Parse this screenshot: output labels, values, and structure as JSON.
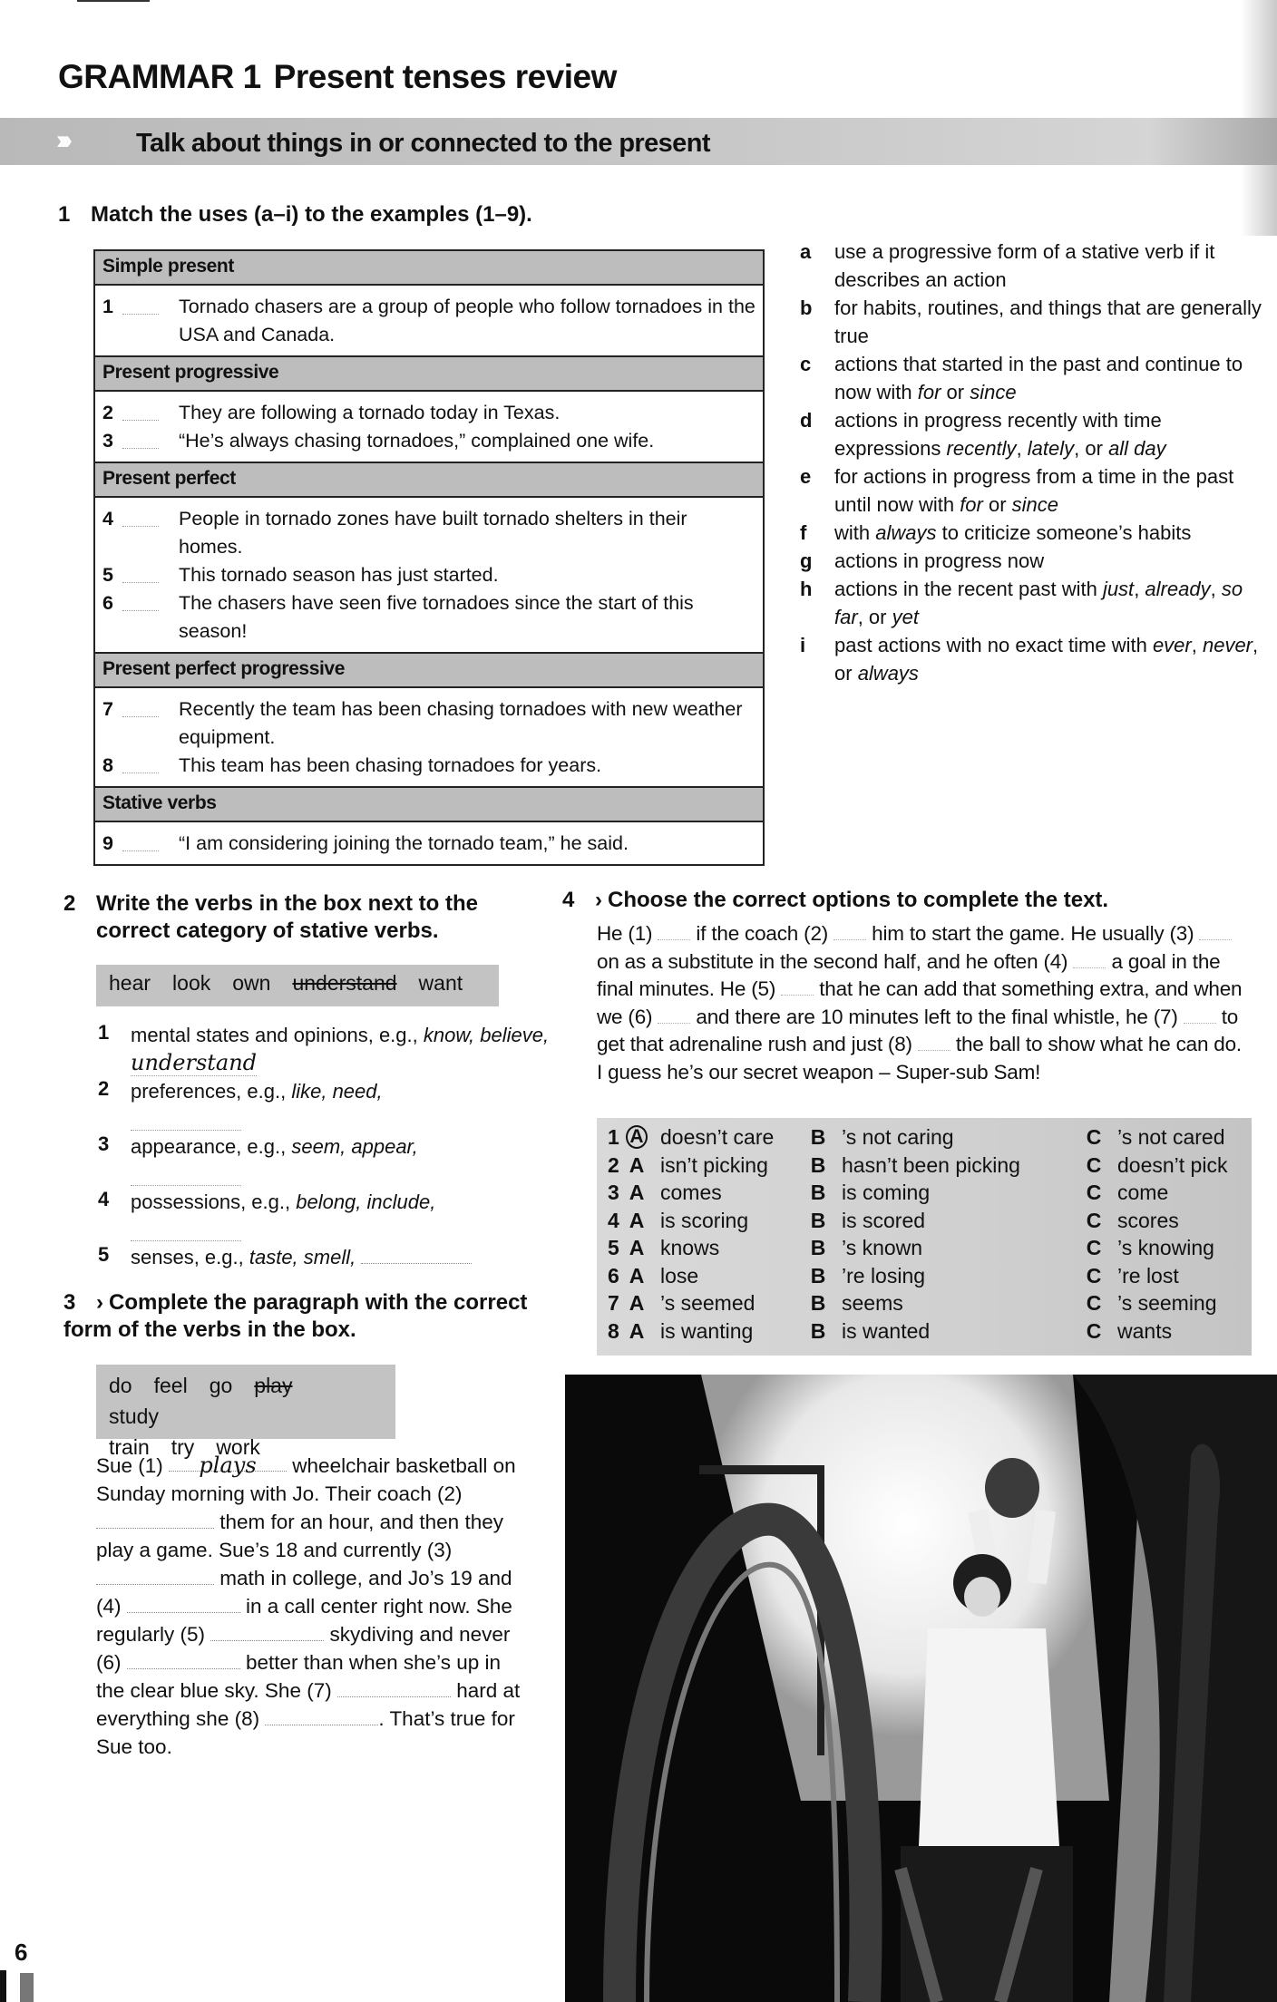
{
  "header": {
    "unit": "GRAMMAR 1",
    "title": "Present tenses review",
    "banner_icon": "triple-chevron-icon",
    "banner_text": "Talk about things in or connected to the present"
  },
  "exercise1": {
    "number": "1",
    "instruction": "Match the uses (a–i) to the examples (1–9).",
    "sections": [
      {
        "heading": "Simple present",
        "items": [
          {
            "n": "1",
            "text": "Tornado chasers are a group of people who follow tornadoes in the USA and Canada."
          }
        ]
      },
      {
        "heading": "Present progressive",
        "items": [
          {
            "n": "2",
            "text": "They are following a tornado today in Texas."
          },
          {
            "n": "3",
            "text": "“He’s always chasing tornadoes,” complained one wife."
          }
        ]
      },
      {
        "heading": "Present perfect",
        "items": [
          {
            "n": "4",
            "text": "People in tornado zones have built tornado shelters in their homes."
          },
          {
            "n": "5",
            "text": "This tornado season has just started."
          },
          {
            "n": "6",
            "text": "The chasers have seen five tornadoes since the start of this season!"
          }
        ]
      },
      {
        "heading": "Present perfect progressive",
        "items": [
          {
            "n": "7",
            "text": "Recently the team has been chasing tornadoes with new weather equipment."
          },
          {
            "n": "8",
            "text": "This team has been chasing tornadoes for years."
          }
        ]
      },
      {
        "heading": "Stative verbs",
        "items": [
          {
            "n": "9",
            "text": "“I am considering joining the tornado team,” he said."
          }
        ]
      }
    ],
    "uses": [
      {
        "letter": "a",
        "text": "use a progressive form of a stative verb if it describes an action"
      },
      {
        "letter": "b",
        "text": "for habits, routines, and things that are generally true"
      },
      {
        "letter": "c",
        "text": "actions that started in the past and continue to now with <i>for</i> or <i>since</i>"
      },
      {
        "letter": "d",
        "text": "actions in progress recently with time expressions <i>recently</i>, <i>lately</i>, or <i>all day</i>"
      },
      {
        "letter": "e",
        "text": "for actions in progress from a time in the past until now with <i>for</i> or <i>since</i>"
      },
      {
        "letter": "f",
        "text": "with <i>always</i> to criticize someone’s habits"
      },
      {
        "letter": "g",
        "text": "actions in progress now"
      },
      {
        "letter": "h",
        "text": "actions in the recent past with <i>just</i>, <i>already</i>, <i>so far</i>, or <i>yet</i>"
      },
      {
        "letter": "i",
        "text": "past actions with no exact time with <i>ever</i>, <i>never</i>, or <i>always</i>"
      }
    ]
  },
  "exercise2": {
    "number": "2",
    "instruction": "Write the verbs in the box next to the correct category of stative verbs.",
    "box_words": [
      {
        "word": "hear",
        "crossed": false
      },
      {
        "word": "look",
        "crossed": false
      },
      {
        "word": "own",
        "crossed": false
      },
      {
        "word": "understand",
        "crossed": true
      },
      {
        "word": "want",
        "crossed": false
      }
    ],
    "categories": [
      {
        "n": "1",
        "text": "mental states and opinions, e.g., <i>know, believe,</i>",
        "answer": "understand"
      },
      {
        "n": "2",
        "text": "preferences, e.g., <i>like, need,</i>",
        "answer": ""
      },
      {
        "n": "3",
        "text": "appearance, e.g., <i>seem, appear,</i>",
        "answer": ""
      },
      {
        "n": "4",
        "text": "possessions, e.g., <i>belong, include,</i>",
        "answer": ""
      },
      {
        "n": "5",
        "text": "senses, e.g., <i>taste, smell,</i>",
        "answer": ""
      }
    ]
  },
  "exercise3": {
    "number": "3",
    "icon": "chevron-right-icon",
    "instruction": "Complete the paragraph with the correct form of the verbs in the box.",
    "box_words": [
      {
        "word": "do",
        "crossed": false
      },
      {
        "word": "feel",
        "crossed": false
      },
      {
        "word": "go",
        "crossed": false
      },
      {
        "word": "play",
        "crossed": true
      },
      {
        "word": "study",
        "crossed": false
      },
      {
        "word": "train",
        "crossed": false
      },
      {
        "word": "try",
        "crossed": false
      },
      {
        "word": "work",
        "crossed": false
      }
    ],
    "paragraph": [
      {
        "t": "Sue (1) "
      },
      {
        "gap": "plays",
        "w": 130
      },
      {
        "t": " wheelchair basketball on Sunday morning with Jo. Their coach (2) "
      },
      {
        "gap": "",
        "w": 130
      },
      {
        "t": " them for an hour, and then they play a game. Sue’s 18 and currently (3) "
      },
      {
        "gap": "",
        "w": 130
      },
      {
        "t": " math in college, and Jo’s 19 and (4) "
      },
      {
        "gap": "",
        "w": 125
      },
      {
        "t": " in a call center right now. She regularly (5) "
      },
      {
        "gap": "",
        "w": 125
      },
      {
        "t": " skydiving and never (6) "
      },
      {
        "gap": "",
        "w": 125
      },
      {
        "t": " better than when she’s up in the clear blue sky. She (7) "
      },
      {
        "gap": "",
        "w": 125
      },
      {
        "t": " hard at everything she (8) "
      },
      {
        "gap": "",
        "w": 125
      },
      {
        "t": ". That’s true for Sue too."
      }
    ]
  },
  "exercise4": {
    "number": "4",
    "icon": "chevron-right-icon",
    "instruction": "Choose the correct options to complete the text.",
    "paragraph": [
      {
        "t": "He (1) "
      },
      {
        "gap": true
      },
      {
        "t": " if the coach (2) "
      },
      {
        "gap": true
      },
      {
        "t": " him to start the game. He usually (3) "
      },
      {
        "gap": true
      },
      {
        "t": " on as a substitute in the second half, and he often (4) "
      },
      {
        "gap": true
      },
      {
        "t": " a goal in the final minutes. He (5) "
      },
      {
        "gap": true
      },
      {
        "t": " that he can add that something extra, and when we (6) "
      },
      {
        "gap": true
      },
      {
        "t": " and there are 10 minutes left to the final whistle, he (7) "
      },
      {
        "gap": true
      },
      {
        "t": " to get that adrenaline rush and just (8) "
      },
      {
        "gap": true
      },
      {
        "t": " the ball to show what he can do. I guess he’s our secret weapon – Super-sub Sam!"
      }
    ],
    "options": [
      {
        "n": "1",
        "A": "doesn’t care",
        "B": "’s not caring",
        "C": "’s not cared",
        "selected": "A"
      },
      {
        "n": "2",
        "A": "isn’t picking",
        "B": "hasn’t been picking",
        "C": "doesn’t pick",
        "selected": ""
      },
      {
        "n": "3",
        "A": "comes",
        "B": "is coming",
        "C": "come",
        "selected": ""
      },
      {
        "n": "4",
        "A": "is scoring",
        "B": "is scored",
        "C": "scores",
        "selected": ""
      },
      {
        "n": "5",
        "A": "knows",
        "B": "’s known",
        "C": "’s knowing",
        "selected": ""
      },
      {
        "n": "6",
        "A": "lose",
        "B": "’re losing",
        "C": "’re lost",
        "selected": ""
      },
      {
        "n": "7",
        "A": "’s seemed",
        "B": "seems",
        "C": "’s seeming",
        "selected": ""
      },
      {
        "n": "8",
        "A": "is wanting",
        "B": "is wanted",
        "C": "wants",
        "selected": ""
      }
    ]
  },
  "photo": {
    "description": "Black-and-white photo of a wheelchair basketball player holding a ball above her head"
  },
  "footer": {
    "page_number": "6"
  }
}
